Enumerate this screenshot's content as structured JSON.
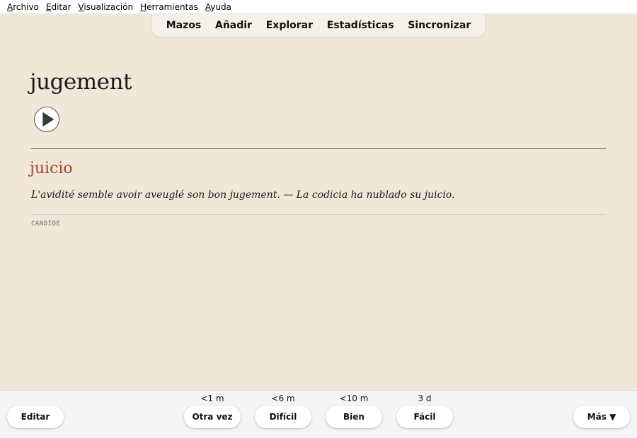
{
  "menu": [
    {
      "first": "A",
      "rest": "rchivo"
    },
    {
      "first": "E",
      "rest": "ditar"
    },
    {
      "first": "V",
      "rest": "isualización"
    },
    {
      "first": "H",
      "rest": "erramientas"
    },
    {
      "first": "A",
      "rest": "yuda"
    }
  ],
  "toolbar": {
    "decks": "Mazos",
    "add": "Añadir",
    "browse": "Explorar",
    "stats": "Estadísticas",
    "sync": "Sincronizar"
  },
  "card": {
    "front": "jugement",
    "back": "juicio",
    "example": "L'avidité semble avoir aveuglé son bon jugement. — La codicia ha nublado su juicio.",
    "source": "CANDIDE"
  },
  "bottom": {
    "edit": "Editar",
    "more": "Más ▼",
    "answers": [
      {
        "label": "Otra vez",
        "interval": "<1 m"
      },
      {
        "label": "Difícil",
        "interval": "<6 m"
      },
      {
        "label": "Bien",
        "interval": "<10 m"
      },
      {
        "label": "Fácil",
        "interval": "3 d"
      }
    ]
  },
  "colors": {
    "background": "#f0e7d8",
    "answer_text": "#b0402a"
  }
}
